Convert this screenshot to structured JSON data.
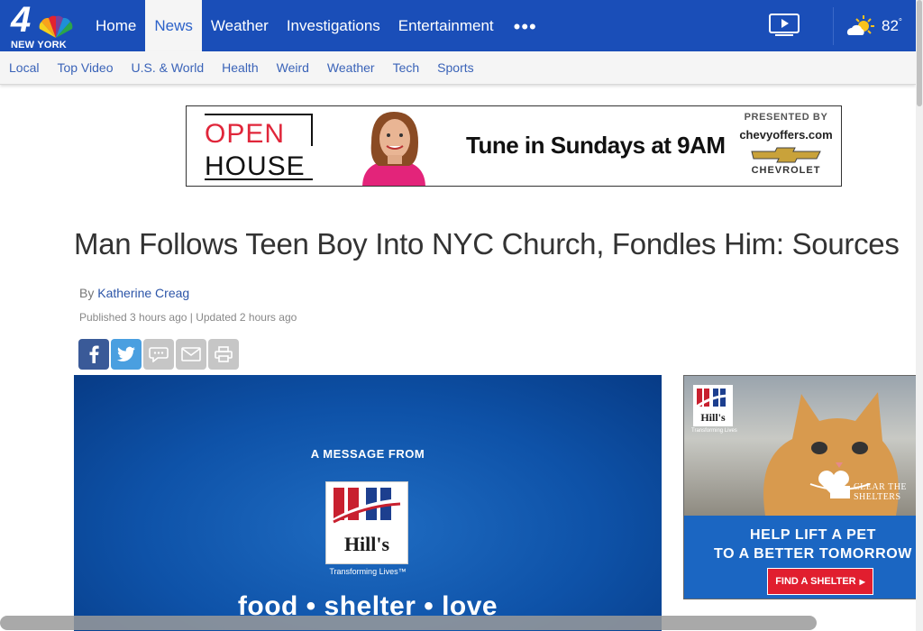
{
  "brand": {
    "channel_number": "4",
    "city": "NEW YORK"
  },
  "nav": {
    "items": [
      {
        "label": "Home",
        "active": false
      },
      {
        "label": "News",
        "active": true
      },
      {
        "label": "Weather",
        "active": false
      },
      {
        "label": "Investigations",
        "active": false
      },
      {
        "label": "Entertainment",
        "active": false
      }
    ],
    "more_label": "•••",
    "video_icon": "play-video-icon"
  },
  "weather": {
    "icon": "partly-sunny-icon",
    "temperature": "82",
    "degree": "°"
  },
  "subnav": {
    "items": [
      "Local",
      "Top Video",
      "U.S. & World",
      "Health",
      "Weird",
      "Weather",
      "Tech",
      "Sports"
    ]
  },
  "top_ad": {
    "line1": "OPEN",
    "line2": "HOUSE",
    "tagline": "Tune in Sundays at 9AM",
    "presented_by": "PRESENTED BY",
    "sponsor_url": "chevyoffers.com",
    "sponsor_brand": "CHEVROLET"
  },
  "article": {
    "headline": "Man Follows Teen Boy Into NYC Church, Fondles Him: Sources",
    "by_prefix": "By",
    "author": "Katherine Creag",
    "dateline": "Published 3 hours ago | Updated 2 hours ago"
  },
  "share": {
    "buttons": [
      "facebook-icon",
      "twitter-icon",
      "comment-icon",
      "email-icon",
      "print-icon"
    ]
  },
  "video_promo": {
    "message": "A MESSAGE FROM",
    "logo_text": "Hill's",
    "tagline": "Transforming Lives™",
    "slogan": "food • shelter • love"
  },
  "side_ad": {
    "logo_text": "Hill's",
    "logo_tag": "Transforming Lives",
    "campaign": "CLEAR THE SHELTERS",
    "headline_line1": "HELP LIFT A PET",
    "headline_line2": "TO A BETTER TOMORROW",
    "cta": "FIND A SHELTER",
    "cta_arrow": "▶"
  },
  "colors": {
    "nav_blue": "#1a4eb8",
    "link_blue": "#3a63b8",
    "promo_blue": "#0e52a8",
    "red": "#e11e2f"
  }
}
